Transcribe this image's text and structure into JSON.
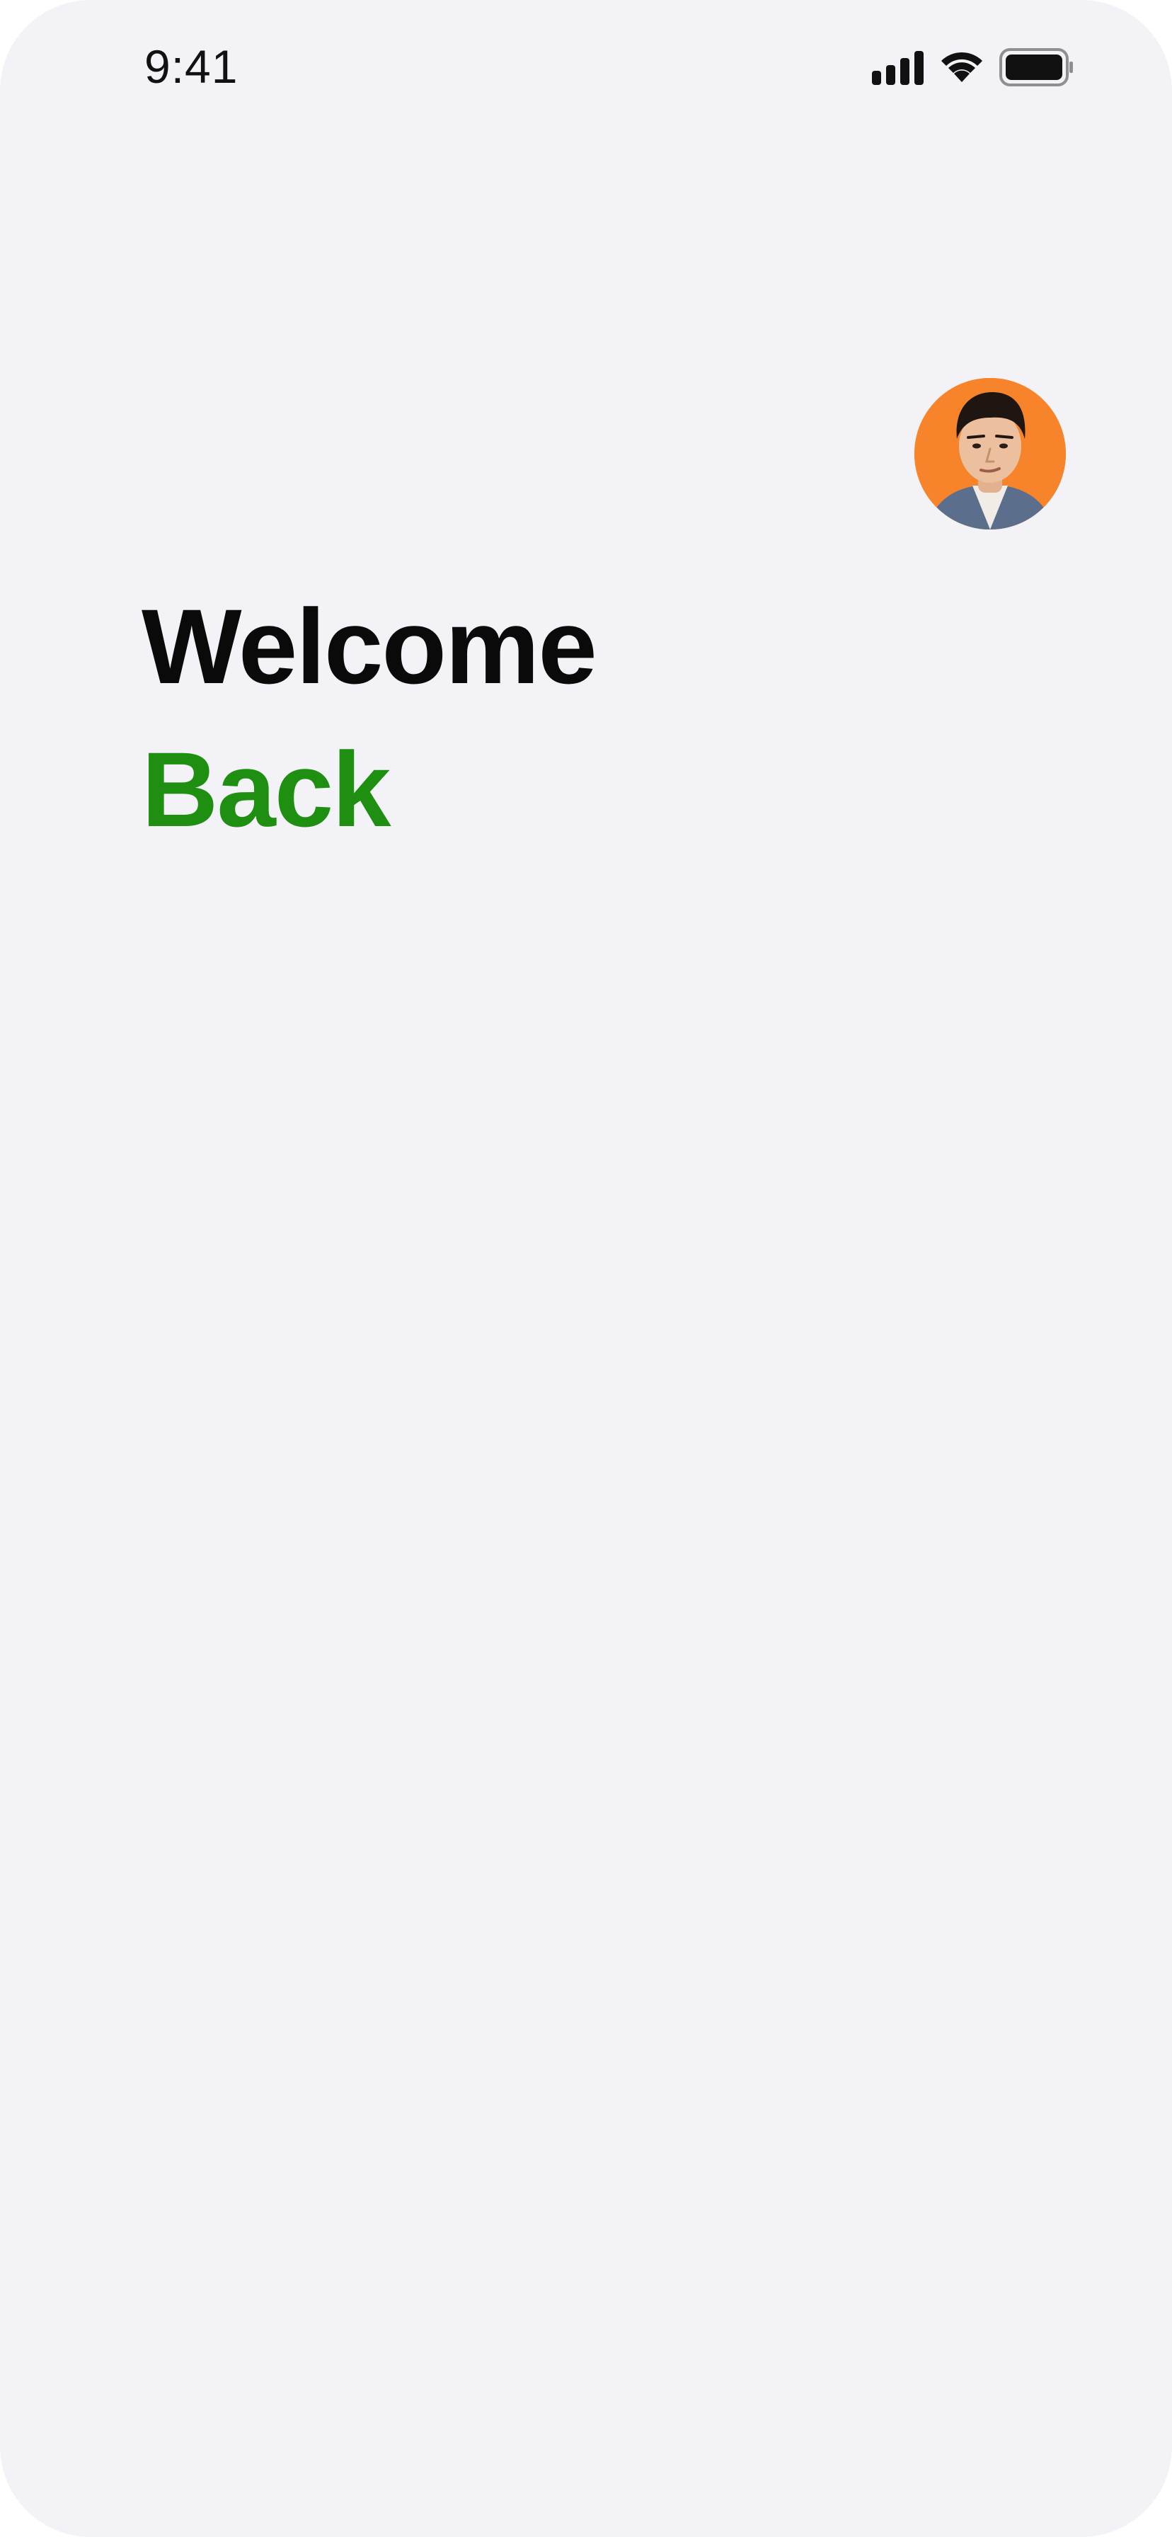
{
  "status_bar": {
    "time": "9:41",
    "icons": [
      "cellular-signal-icon",
      "wifi-icon",
      "battery-icon"
    ]
  },
  "profile": {
    "avatar": "user-avatar"
  },
  "greeting": {
    "line1": "Welcome",
    "line2": "Back"
  },
  "colors": {
    "background": "#f3f2f7",
    "text_primary": "#0a0a0a",
    "accent_green": "#1f8f12",
    "avatar_background": "#f7842a"
  }
}
